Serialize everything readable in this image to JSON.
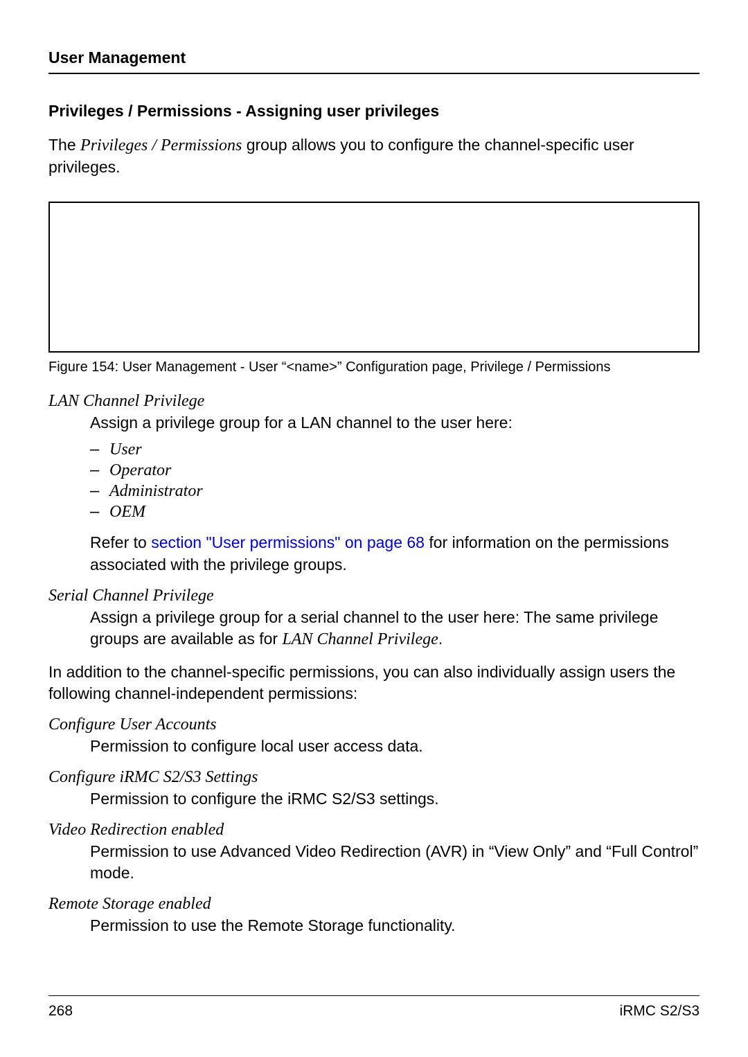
{
  "header": {
    "title": "User Management"
  },
  "section": {
    "title": "Privileges / Permissions - Assigning user privileges"
  },
  "intro": {
    "prefix": "The ",
    "italic": "Privileges / Permissions",
    "suffix": "  group allows you to configure the channel-specific user privileges."
  },
  "figure": {
    "caption": "Figure 154: User Management - User “<name>” Configuration page, Privilege / Permissions"
  },
  "lan": {
    "term": "LAN Channel Privilege",
    "desc": "Assign a privilege group for a LAN channel to the user here:",
    "items": [
      "User",
      "Operator",
      "Administrator",
      "OEM"
    ],
    "ref_prefix": "Refer to ",
    "ref_link": "section \"User permissions\" on page 68",
    "ref_suffix": " for information on the permissions associated with the privilege groups."
  },
  "serial": {
    "term": "Serial Channel Privilege",
    "desc_prefix": "Assign a privilege group for a serial channel to the user here: The same privilege groups are available as for ",
    "desc_italic": "LAN Channel Privilege",
    "desc_suffix": "."
  },
  "mid_para": "In addition to the channel-specific permissions, you can also individually assign users the following channel-independent permissions:",
  "cua": {
    "term": "Configure User Accounts",
    "desc": "Permission to configure local user access data."
  },
  "cis": {
    "term": "Configure iRMC S2/S3 Settings",
    "desc": "Permission to configure the iRMC S2/S3 settings."
  },
  "vre": {
    "term": "Video Redirection enabled",
    "desc": "Permission to use Advanced Video Redirection (AVR) in “View Only” and “Full Control” mode."
  },
  "rse": {
    "term": "Remote Storage enabled",
    "desc": "Permission to use the Remote Storage functionality."
  },
  "footer": {
    "page": "268",
    "product": "iRMC S2/S3"
  }
}
